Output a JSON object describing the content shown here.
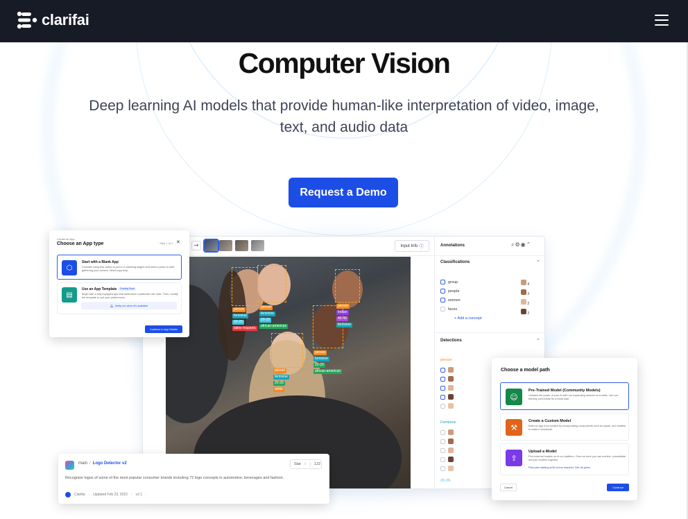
{
  "header": {
    "brand": "clarifai",
    "menu_icon": "hamburger-menu-icon"
  },
  "hero": {
    "title": "Computer Vision",
    "subtitle": "Deep learning AI models that provide human-like interpretation of video, image, text, and audio data",
    "cta": "Request a Demo"
  },
  "create_app": {
    "eyebrow": "Create an App",
    "title": "Choose an App type",
    "step": "Step 1 of 2",
    "options": [
      {
        "title": "Start with a Blank App",
        "desc": "Consider using this option is you're in planning stages and need a place to start gathering your content. Need copy help.",
        "badge": ""
      },
      {
        "title": "Use an App Template",
        "desc": "Begin with a fully equipped app that addresses a particular use case. Then, modify the template to suit your preferences.",
        "badge": "Coming Soon"
      }
    ],
    "notify": "Verify me when it's available",
    "continue": "Continue to App Details"
  },
  "annotator": {
    "input_info": "Input Info",
    "annotations_title": "Annotations",
    "classifications_title": "Classifications",
    "classifications": [
      {
        "label": "group",
        "count": "4",
        "checked": true
      },
      {
        "label": "people",
        "count": "3",
        "checked": true
      },
      {
        "label": "women",
        "count": "2",
        "checked": true
      },
      {
        "label": "faces",
        "count": "2",
        "checked": false
      }
    ],
    "add_concept": "+ Add a concept",
    "detections_title": "Detections",
    "detection_groups": [
      "person",
      "Feminine",
      "20-29"
    ],
    "tags": {
      "left": [
        "person",
        "feminine",
        "20-29",
        "latino-hispanic"
      ],
      "center": [
        "person",
        "feminine",
        "20-29",
        "african-american"
      ],
      "right": [
        "person",
        "Indian",
        "40-49",
        "feminine"
      ],
      "middle": [
        "person",
        "feminine",
        "20-29",
        "african-american"
      ],
      "bottom": [
        "person",
        "feminine",
        "20-29",
        "white"
      ]
    }
  },
  "repo": {
    "owner": "main",
    "sep": "/",
    "name": "Logo Detector v2",
    "star_label": "Star",
    "star_count": "122",
    "desc": "Recognize logos of some of the most popular consumer brands including 72 logo concepts in automotive, beverages and fashion.",
    "org": "Clarifai",
    "updated": "Updated Feb 23, 2022",
    "version": "v2.1"
  },
  "model_path": {
    "title": "Choose a model path",
    "options": [
      {
        "title": "Pre-Trained Model (Community Models)",
        "desc": "Unleash the power of your AI with our expanding network of models. Join our thriving community for a head start."
      },
      {
        "title": "Create a Custom Model",
        "desc": "Build an app from scratch by incorporating components such as inputs, and models, to make it functional."
      },
      {
        "title": "Upload a Model",
        "desc": "Port external models on to our platform. Once on here you can monitor, consolidate and join modern together.",
        "note": "Paid plan starting at $x.xx/mo required. See all plans"
      }
    ],
    "cancel": "Cancel",
    "continue": "Continue"
  }
}
